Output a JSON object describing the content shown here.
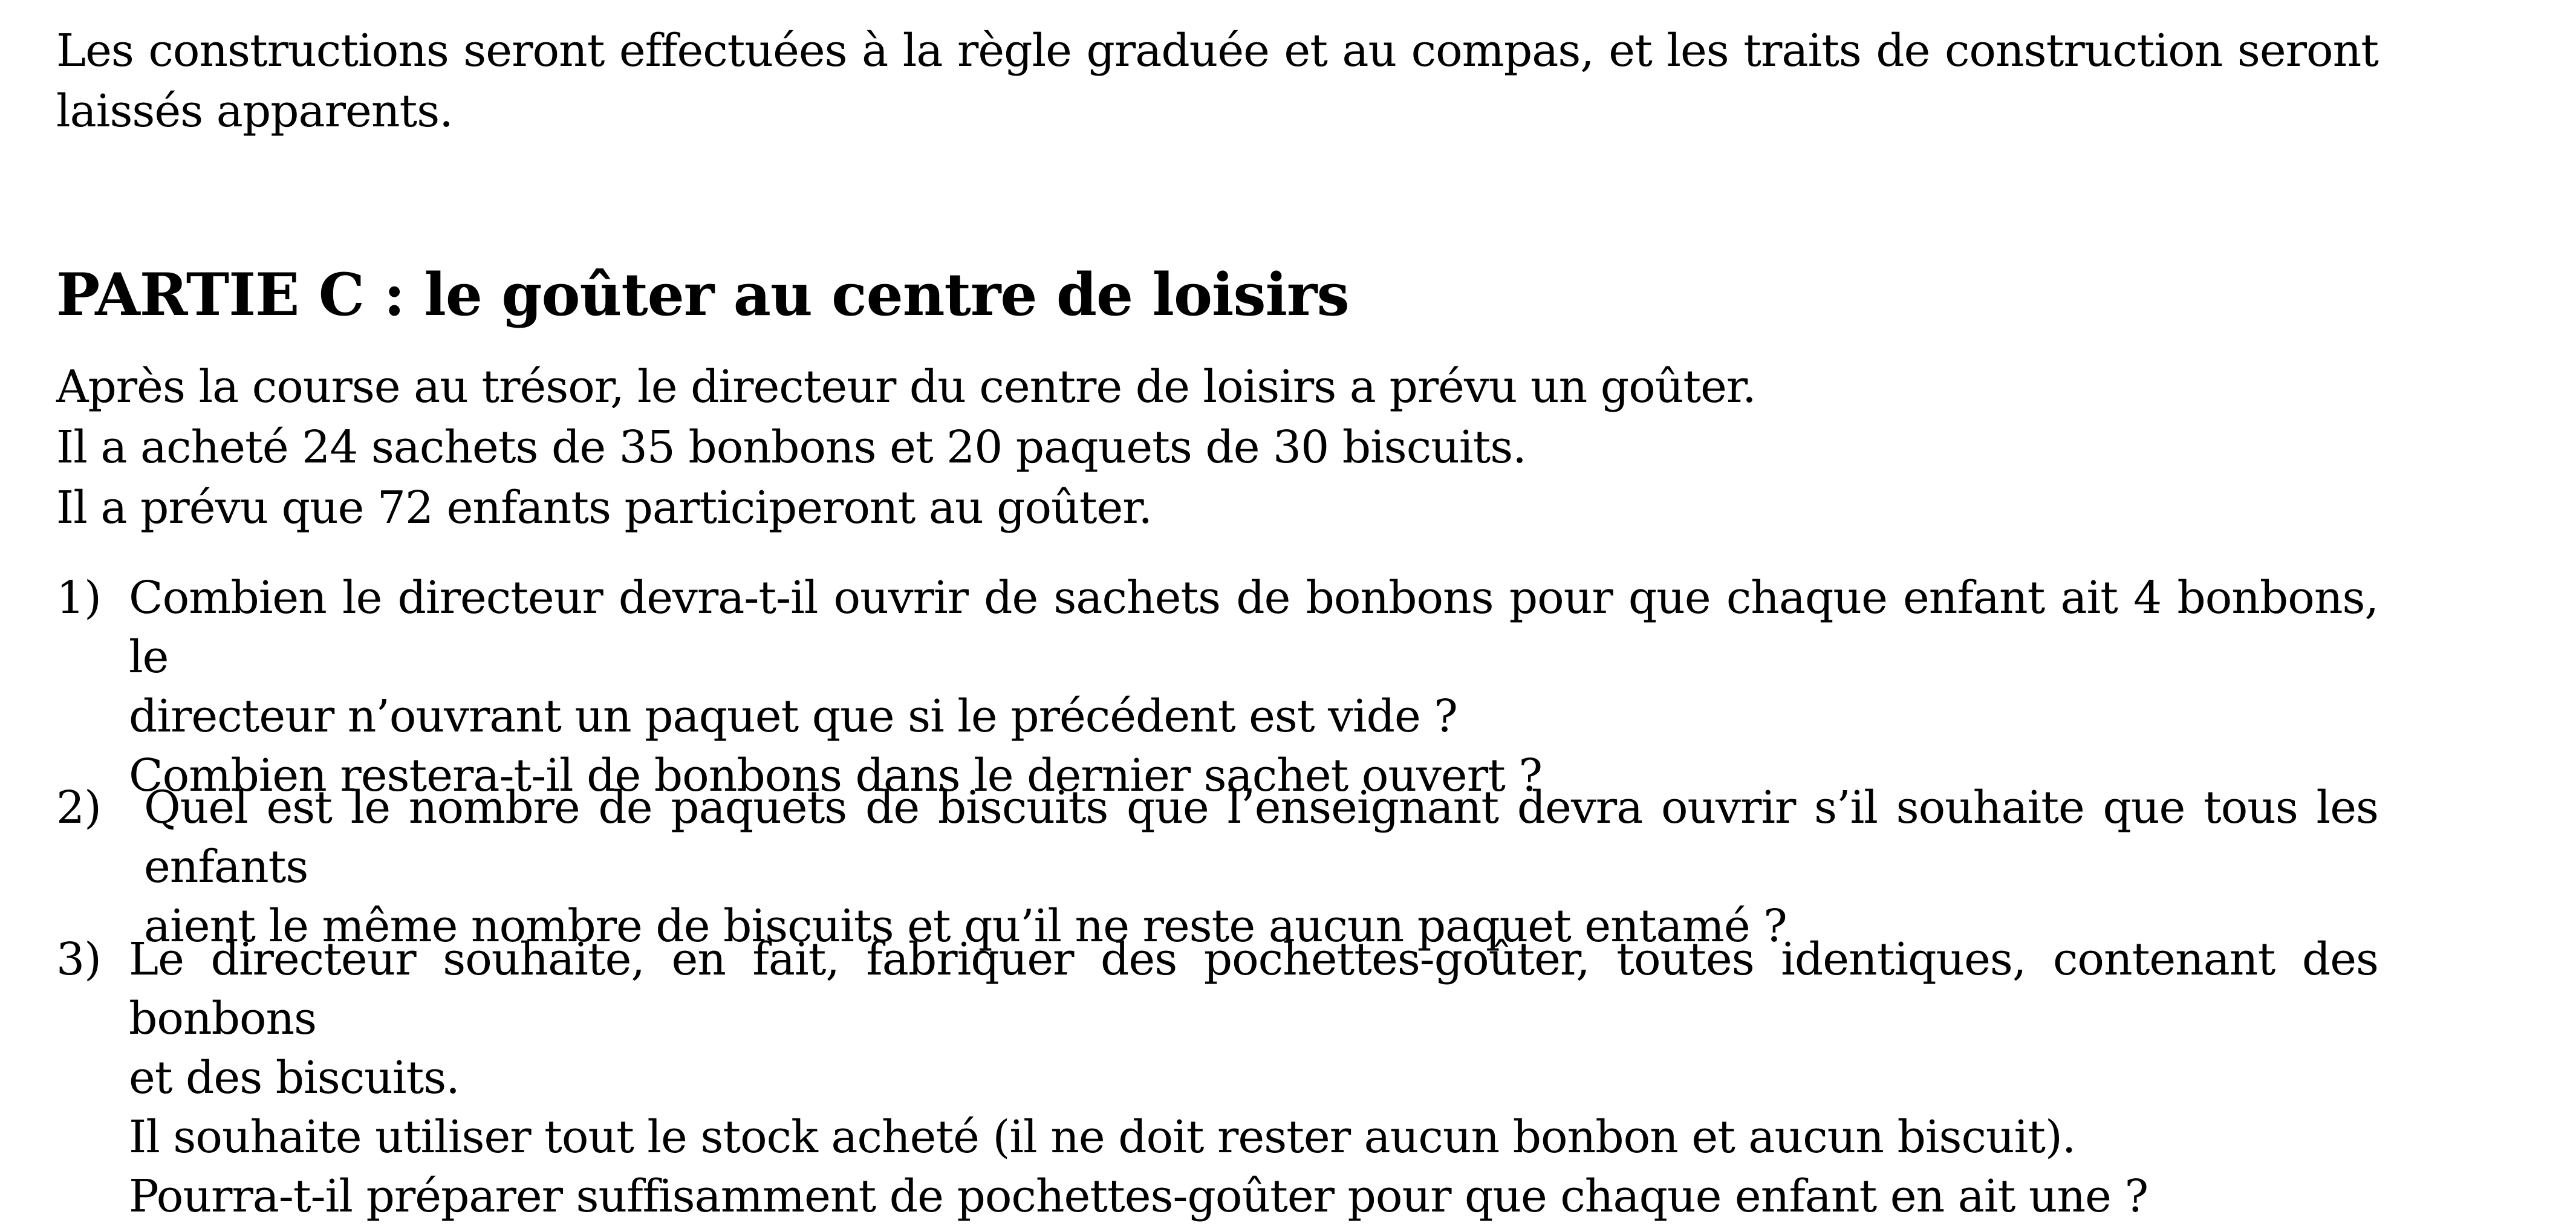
{
  "intro": "Les constructions seront effectuées à la règle graduée et au compas, et les traits de construction seront laissés apparents.",
  "heading": "PARTIE C : le goûter au centre de loisirs",
  "statement": [
    "Après la course au trésor, le directeur du centre de loisirs a prévu un goûter.",
    "Il a acheté 24 sachets de 35 bonbons et 20 paquets de 30 biscuits.",
    "Il a prévu que 72 enfants participeront au goûter."
  ],
  "questions": [
    {
      "number": "1)",
      "lines": [
        "Combien le directeur devra-t-il ouvrir de sachets de bonbons pour que chaque enfant ait 4 bonbons, le",
        "directeur n’ouvrant un paquet que si le précédent est vide ?",
        "Combien restera-t-il de bonbons dans le dernier sachet ouvert ?"
      ]
    },
    {
      "number": "2)",
      "lines": [
        "Quel est le nombre de paquets de biscuits que l’enseignant devra ouvrir s’il souhaite que tous les enfants",
        "aient le même nombre de biscuits et qu’il ne reste aucun paquet entamé ?"
      ]
    },
    {
      "number": "3)",
      "lines": [
        "Le directeur souhaite, en fait, fabriquer des pochettes-goûter, toutes identiques, contenant des bonbons",
        "et des biscuits.",
        "Il souhaite utiliser tout le stock acheté (il ne doit rester aucun bonbon et aucun biscuit).",
        "Pourra-t-il préparer suffisamment de pochettes-goûter pour que chaque enfant en ait une ?"
      ]
    }
  ]
}
